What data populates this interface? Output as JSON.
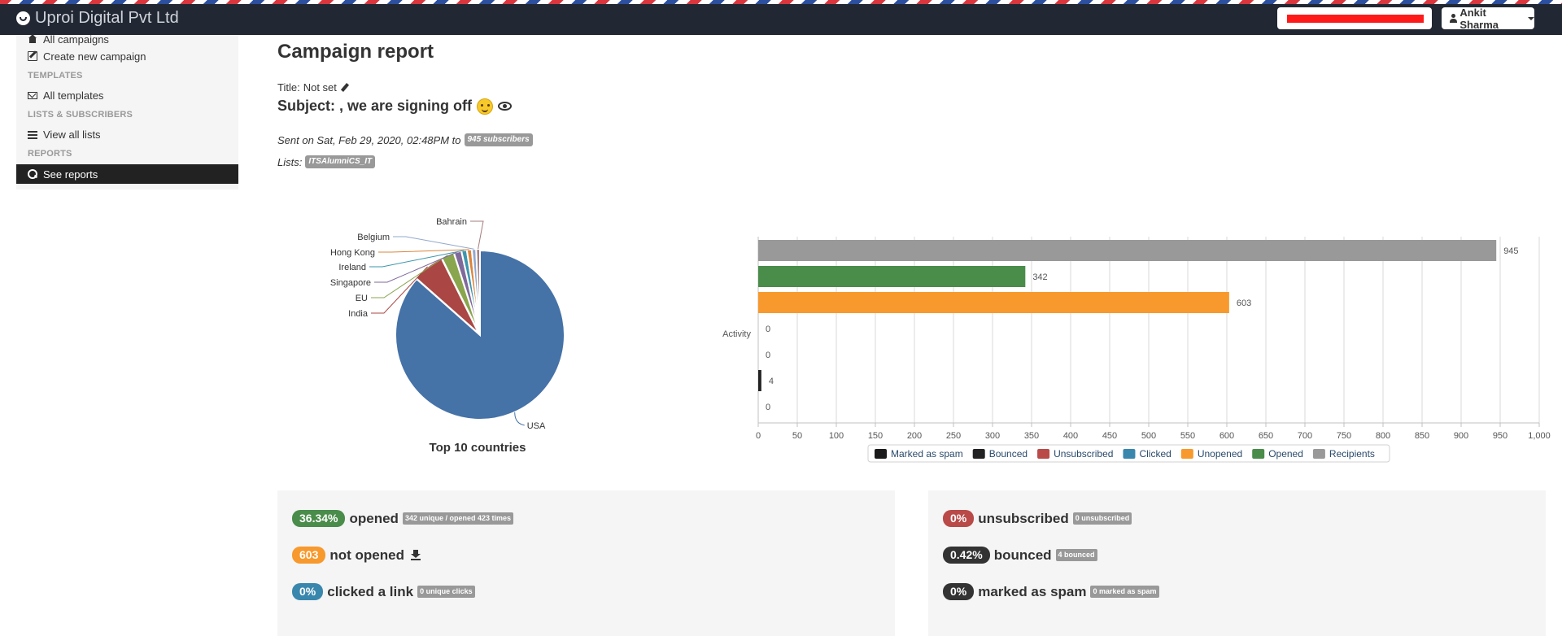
{
  "navbar": {
    "brand": "Uproi Digital Pvt Ltd",
    "user_name": "Ankit Sharma"
  },
  "sidebar": {
    "items": [
      {
        "label": "All campaigns",
        "icon": "home-icon"
      },
      {
        "label": "Create new campaign",
        "icon": "edit-icon"
      },
      {
        "section": "TEMPLATES"
      },
      {
        "label": "All templates",
        "icon": "envelope-icon"
      },
      {
        "section": "LISTS & SUBSCRIBERS"
      },
      {
        "label": "View all lists",
        "icon": "list-icon"
      },
      {
        "section": "REPORTS"
      },
      {
        "label": "See reports",
        "icon": "search-icon",
        "active": true
      }
    ]
  },
  "report": {
    "heading": "Campaign report",
    "title_label": "Title:",
    "title_value": "Not set",
    "subject": "Subject: , we are signing off",
    "sent_text": "Sent on Sat, Feb 29, 2020, 02:48PM to",
    "subscribers_badge": "945 subscribers",
    "lists_label": "Lists:",
    "list_badge": "ITSAlumniCS_IT"
  },
  "chart_data": [
    {
      "type": "pie",
      "title": "Top 10 countries",
      "slices": [
        {
          "label": "USA",
          "value": 84.8,
          "color": "#4572a7"
        },
        {
          "label": "India",
          "value": 6.0,
          "color": "#aa4643"
        },
        {
          "label": "EU",
          "value": 2.4,
          "color": "#89a54e"
        },
        {
          "label": "Singapore",
          "value": 1.4,
          "color": "#80699b"
        },
        {
          "label": "Ireland",
          "value": 1.0,
          "color": "#3d96ae"
        },
        {
          "label": "Hong Kong",
          "value": 0.9,
          "color": "#db843d"
        },
        {
          "label": "Belgium",
          "value": 0.8,
          "color": "#92a8cd"
        },
        {
          "label": "Bahrain",
          "value": 0.7,
          "color": "#a47d7c"
        }
      ]
    },
    {
      "type": "bar",
      "orientation": "horizontal",
      "category_label": "Activity",
      "series": [
        {
          "name": "Recipients",
          "value": 945,
          "color": "#999999"
        },
        {
          "name": "Opened",
          "value": 342,
          "color": "#4a8c4a"
        },
        {
          "name": "Unopened",
          "value": 603,
          "color": "#f7992d"
        },
        {
          "name": "Clicked",
          "value": 0,
          "color": "#3a87ad"
        },
        {
          "name": "Unsubscribed",
          "value": 0,
          "color": "#b94a48"
        },
        {
          "name": "Bounced",
          "value": 4,
          "color": "#222222"
        },
        {
          "name": "Marked as spam",
          "value": 0,
          "color": "#1a1a1a"
        }
      ],
      "legend_order": [
        "Marked as spam",
        "Bounced",
        "Unsubscribed",
        "Clicked",
        "Unopened",
        "Opened",
        "Recipients"
      ],
      "xlim": [
        0,
        1000
      ],
      "xticks": [
        "0",
        "50",
        "100",
        "150",
        "200",
        "250",
        "300",
        "350",
        "400",
        "450",
        "500",
        "550",
        "600",
        "650",
        "700",
        "750",
        "800",
        "850",
        "900",
        "950",
        "1,000"
      ]
    }
  ],
  "stats_left": [
    {
      "pct": "36.34%",
      "label": "opened",
      "tag": "342 unique / opened 423 times",
      "color": "#4a8c4a"
    },
    {
      "pct": "603",
      "label": "not opened",
      "download": true,
      "color": "#f7992d"
    },
    {
      "pct": "0%",
      "label": "clicked a link",
      "tag": "0 unique clicks",
      "color": "#3a87ad"
    }
  ],
  "stats_right": [
    {
      "pct": "0%",
      "label": "unsubscribed",
      "tag": "0 unsubscribed",
      "color": "#b94a48"
    },
    {
      "pct": "0.42%",
      "label": "bounced",
      "tag": "4 bounced",
      "color": "#333333"
    },
    {
      "pct": "0%",
      "label": "marked as spam",
      "tag": "0 marked as spam",
      "color": "#333333"
    }
  ]
}
